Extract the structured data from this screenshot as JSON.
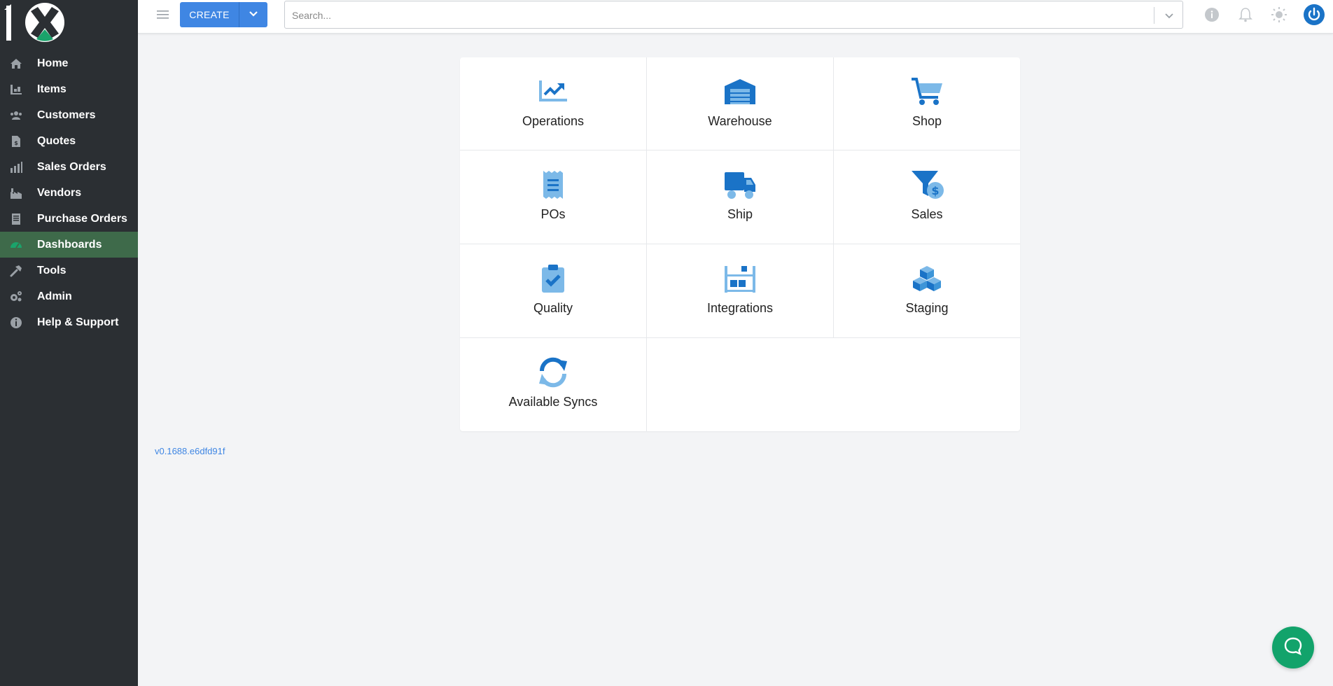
{
  "sidebar": {
    "logo_text": "1X",
    "items": [
      {
        "label": "Home",
        "icon": "home-icon"
      },
      {
        "label": "Items",
        "icon": "items-icon"
      },
      {
        "label": "Customers",
        "icon": "customers-icon"
      },
      {
        "label": "Quotes",
        "icon": "quotes-icon"
      },
      {
        "label": "Sales Orders",
        "icon": "sales-orders-icon"
      },
      {
        "label": "Vendors",
        "icon": "vendors-icon"
      },
      {
        "label": "Purchase Orders",
        "icon": "purchase-orders-icon"
      },
      {
        "label": "Dashboards",
        "icon": "dashboards-icon",
        "active": true
      },
      {
        "label": "Tools",
        "icon": "tools-icon"
      },
      {
        "label": "Admin",
        "icon": "admin-icon"
      },
      {
        "label": "Help & Support",
        "icon": "help-icon"
      }
    ]
  },
  "topbar": {
    "create_label": "CREATE",
    "search_placeholder": "Search..."
  },
  "dashboard": {
    "tiles": [
      {
        "label": "Operations",
        "icon": "chart-line-icon"
      },
      {
        "label": "Warehouse",
        "icon": "warehouse-icon"
      },
      {
        "label": "Shop",
        "icon": "cart-icon"
      },
      {
        "label": "POs",
        "icon": "receipt-icon"
      },
      {
        "label": "Ship",
        "icon": "truck-icon"
      },
      {
        "label": "Sales",
        "icon": "funnel-dollar-icon"
      },
      {
        "label": "Quality",
        "icon": "clipboard-check-icon"
      },
      {
        "label": "Integrations",
        "icon": "shelves-icon"
      },
      {
        "label": "Staging",
        "icon": "cubes-icon"
      },
      {
        "label": "Available Syncs",
        "icon": "sync-icon"
      }
    ]
  },
  "footer": {
    "version": "v0.1688.e6dfd91f"
  },
  "colors": {
    "sidebar_bg": "#2b2f33",
    "active_bg": "#3e6a4a",
    "primary": "#3f86e3",
    "icon_dark": "#1a73c7",
    "icon_light": "#7cb9e8",
    "chat": "#12a36b"
  }
}
